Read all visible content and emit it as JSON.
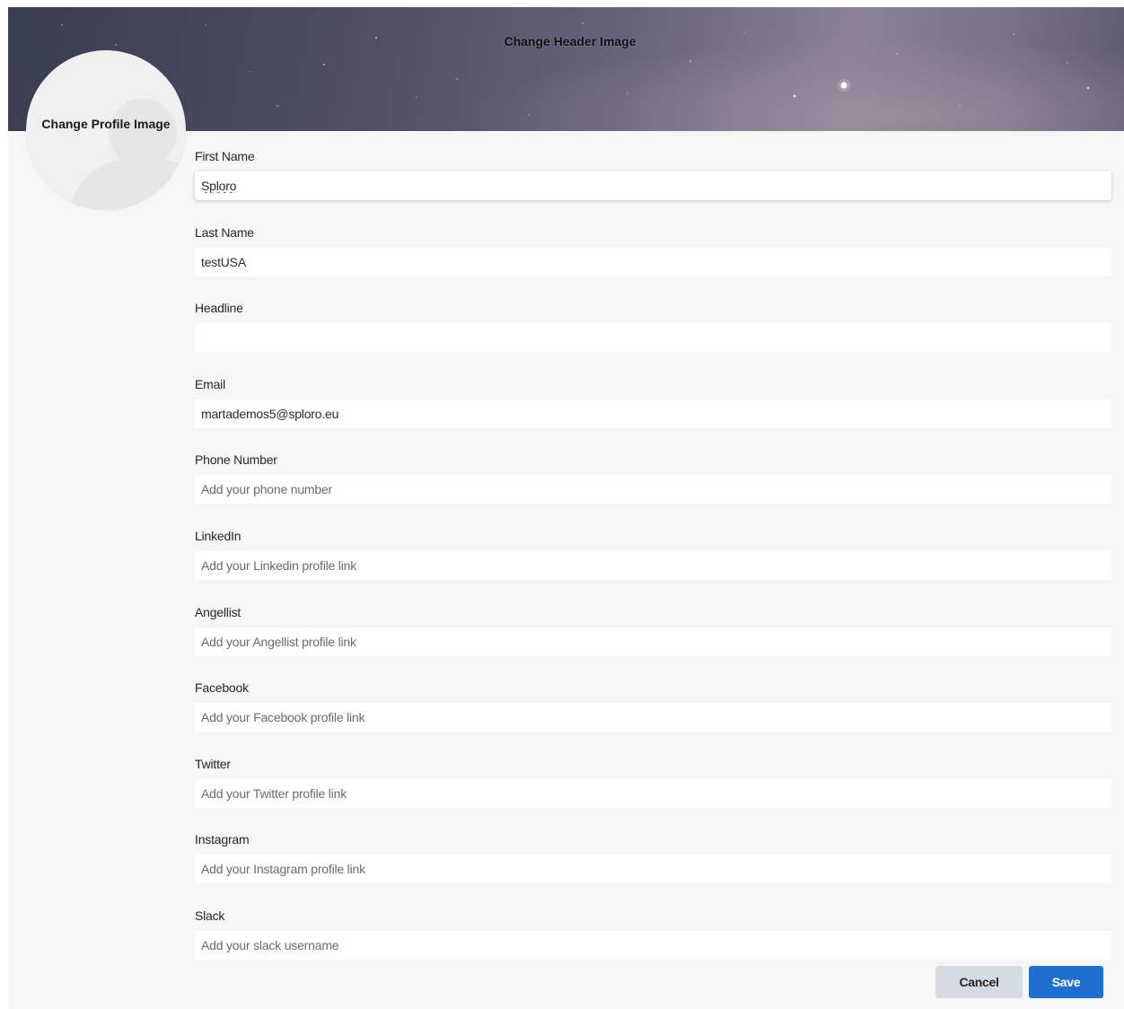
{
  "header": {
    "title": "Change Header Image"
  },
  "profile_image": {
    "label": "Change Profile Image"
  },
  "fields": [
    {
      "label": "First Name",
      "value": "Sploro",
      "placeholder": ""
    },
    {
      "label": "Last Name",
      "value": "testUSA",
      "placeholder": ""
    },
    {
      "label": "Headline",
      "value": "",
      "placeholder": ""
    },
    {
      "label": "Email",
      "value": "martademos5@sploro.eu",
      "placeholder": ""
    },
    {
      "label": "Phone Number",
      "value": "",
      "placeholder": "Add your phone number"
    },
    {
      "label": "LinkedIn",
      "value": "",
      "placeholder": "Add your Linkedin profile link"
    },
    {
      "label": "Angellist",
      "value": "",
      "placeholder": "Add your Angellist profile link"
    },
    {
      "label": "Facebook",
      "value": "",
      "placeholder": "Add your Facebook profile link"
    },
    {
      "label": "Twitter",
      "value": "",
      "placeholder": "Add your Twitter profile link"
    },
    {
      "label": "Instagram",
      "value": "",
      "placeholder": "Add your Instagram profile link"
    },
    {
      "label": "Slack",
      "value": "",
      "placeholder": "Add your slack username"
    }
  ],
  "actions": {
    "cancel_label": "Cancel",
    "save_label": "Save"
  },
  "colors": {
    "panel_bg": "#f6f6f6",
    "save_button": "#1f6fd1",
    "cancel_button": "#d4dbe3"
  }
}
